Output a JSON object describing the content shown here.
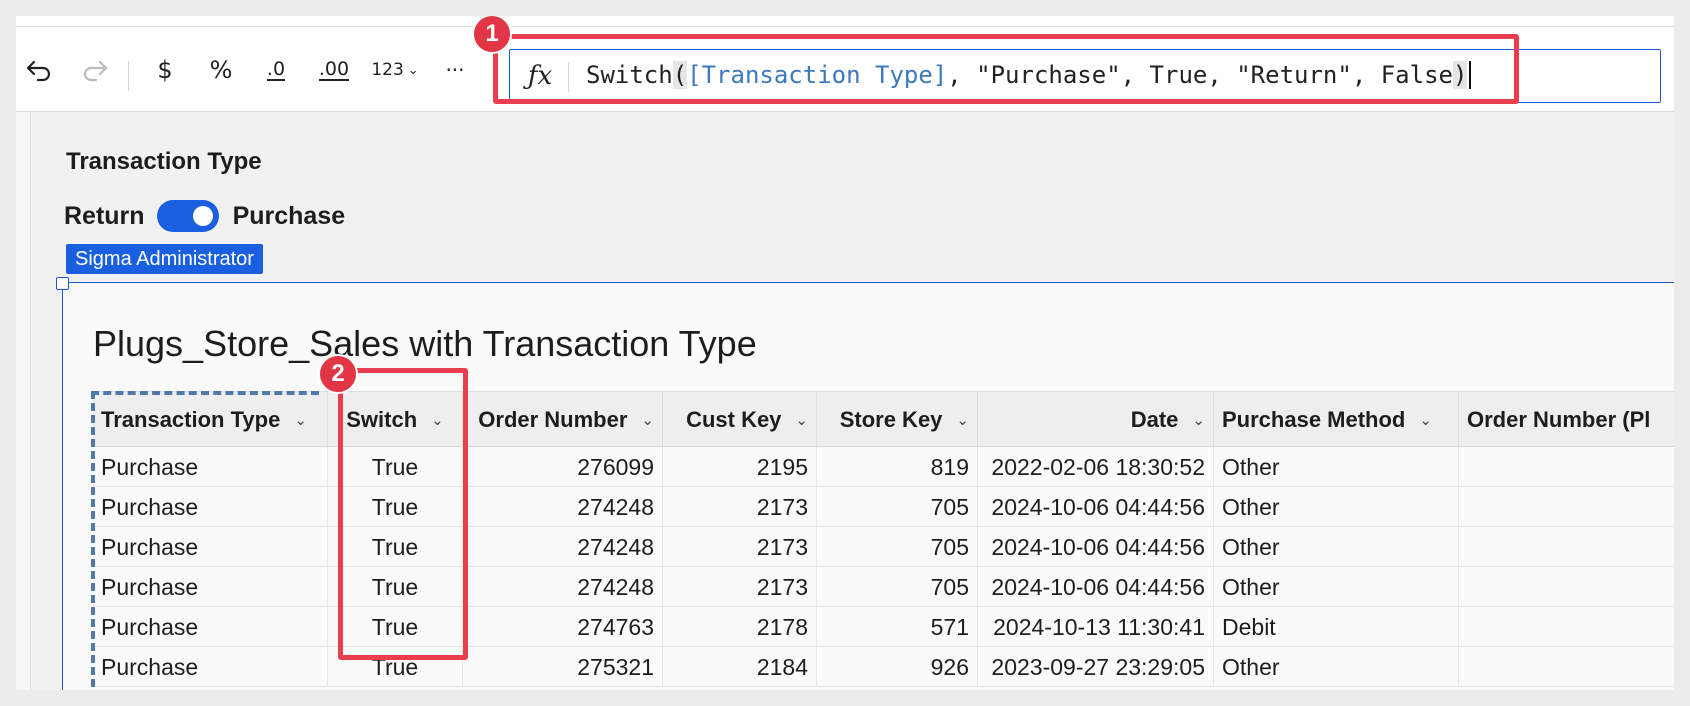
{
  "toolbar": {
    "undo_icon": "undo-icon",
    "redo_icon": "redo-icon",
    "currency_label": "$",
    "percent_label": "%",
    "decrease_decimals_label": ".0",
    "increase_decimals_label": ".00",
    "number_format_label": "123",
    "more_label": "···"
  },
  "formula": {
    "fx_label": "ƒx",
    "func": "Switch",
    "open": "(",
    "ref": "[Transaction Type]",
    "rest": ", \"Purchase\", True, \"Return\", False",
    "close": ")"
  },
  "callouts": {
    "one": "1",
    "two": "2"
  },
  "control": {
    "title": "Transaction Type",
    "left_label": "Return",
    "right_label": "Purchase",
    "toggle_on": true,
    "user_tag": "Sigma Administrator"
  },
  "table": {
    "title": "Plugs_Store_Sales with Transaction Type",
    "columns": [
      "Transaction Type",
      "Switch",
      "Order Number",
      "Cust Key",
      "Store Key",
      "Date",
      "Purchase Method",
      "Order Number (Pl"
    ],
    "rows": [
      [
        "Purchase",
        "True",
        "276099",
        "2195",
        "819",
        "2022-02-06 18:30:52",
        "Other",
        ""
      ],
      [
        "Purchase",
        "True",
        "274248",
        "2173",
        "705",
        "2024-10-06 04:44:56",
        "Other",
        ""
      ],
      [
        "Purchase",
        "True",
        "274248",
        "2173",
        "705",
        "2024-10-06 04:44:56",
        "Other",
        ""
      ],
      [
        "Purchase",
        "True",
        "274248",
        "2173",
        "705",
        "2024-10-06 04:44:56",
        "Other",
        ""
      ],
      [
        "Purchase",
        "True",
        "274763",
        "2178",
        "571",
        "2024-10-13 11:30:41",
        "Debit",
        ""
      ],
      [
        "Purchase",
        "True",
        "275321",
        "2184",
        "926",
        "2023-09-27 23:29:05",
        "Other",
        ""
      ]
    ]
  },
  "colors": {
    "accent": "#1a5fe0",
    "callout": "#ea3d4f",
    "formula_ref": "#3d79bd"
  }
}
